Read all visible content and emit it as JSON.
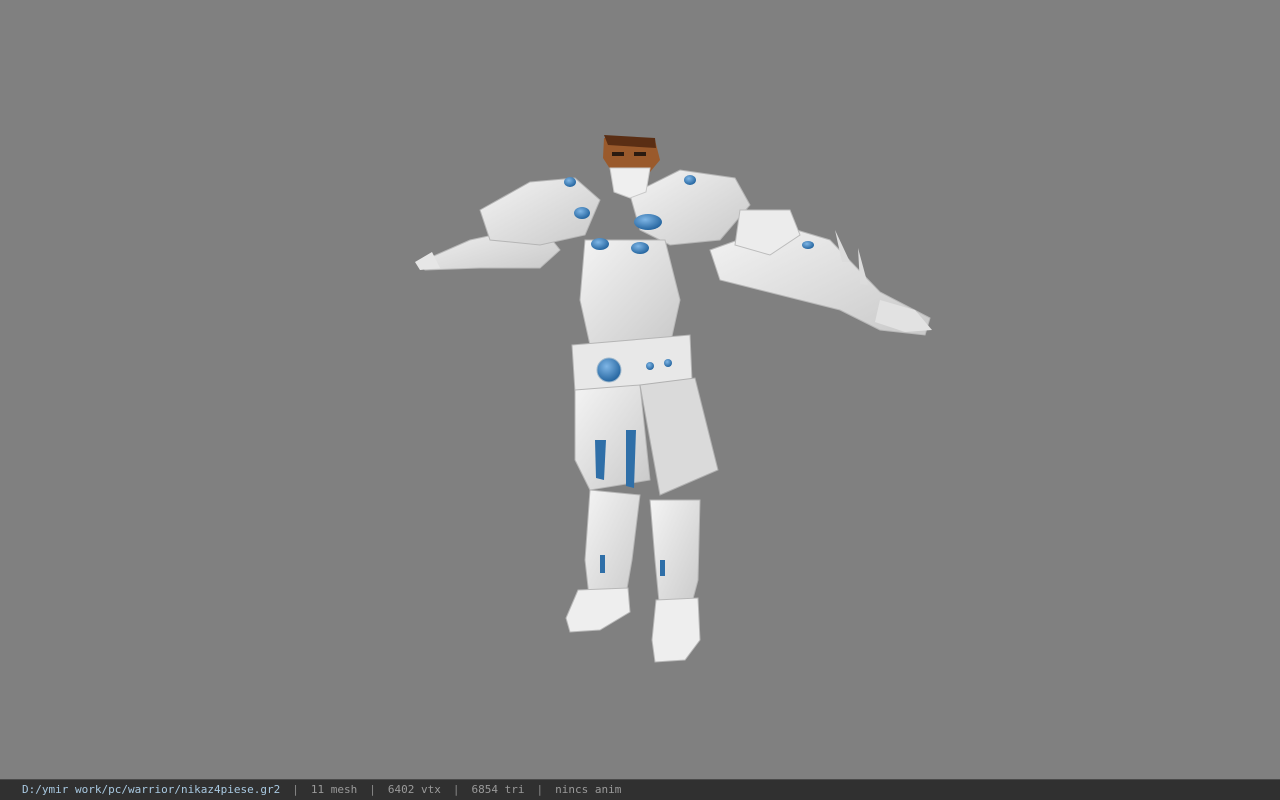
{
  "viewer": {
    "background_color": "#808080",
    "model_icon": "armored-warrior-model"
  },
  "statusbar": {
    "file_path": "D:/ymir work/pc/warrior/nikaz4piese.gr2",
    "separator": "|",
    "mesh_count": "11 mesh",
    "vertex_count": "6402 vtx",
    "triangle_count": "6854 tri",
    "animation": "nincs anim"
  }
}
